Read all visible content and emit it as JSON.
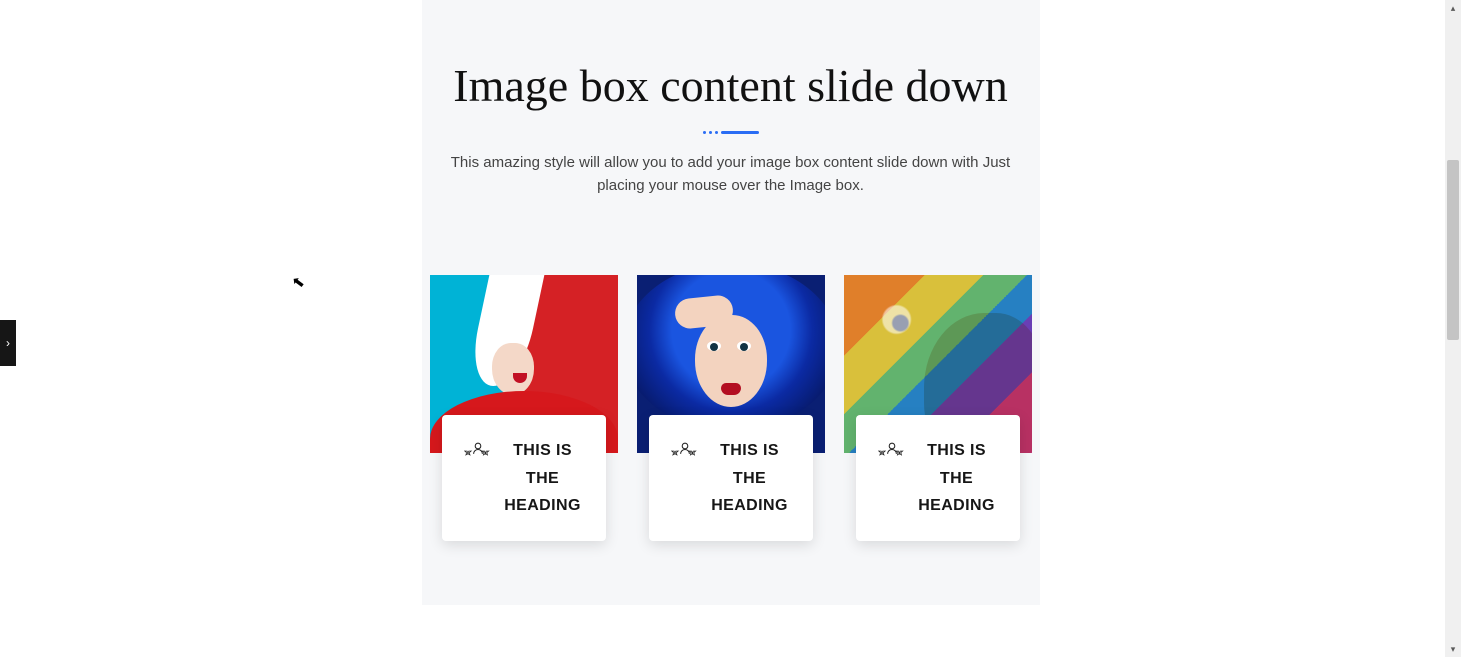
{
  "section": {
    "title": "Image box content slide down",
    "subtitle": "This amazing style will allow you to add your image box content slide down with Just placing your mouse over the Image box."
  },
  "cards": [
    {
      "icon": "rating-users-icon",
      "heading": "THIS IS THE HEADING"
    },
    {
      "icon": "rating-users-icon",
      "heading": "THIS IS THE HEADING"
    },
    {
      "icon": "rating-users-icon",
      "heading": "THIS IS THE HEADING"
    }
  ],
  "sideTab": {
    "glyph": "›"
  },
  "scrollbar": {
    "up": "▴",
    "down": "▾"
  }
}
